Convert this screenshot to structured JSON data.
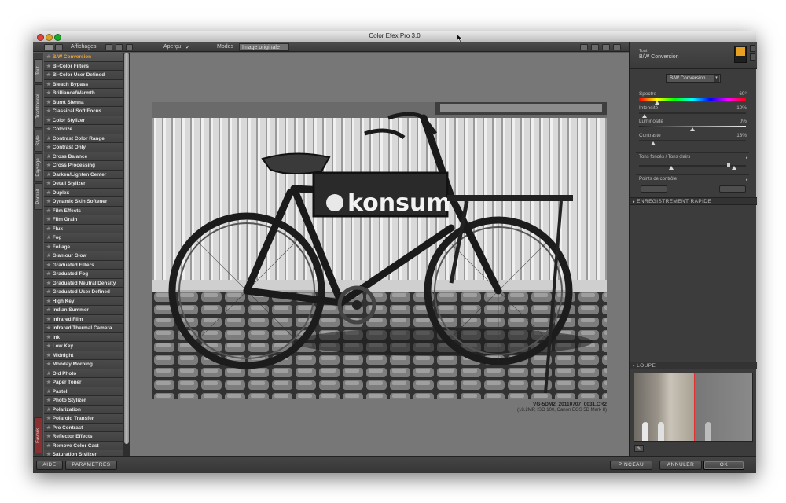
{
  "window": {
    "title": "Color Efex Pro 3.0"
  },
  "toolbar": {
    "affichages_label": "Affichages",
    "apercu_label": "Aperçu",
    "modes_label": "Modes",
    "modes_value": "Image originale"
  },
  "left_tabs": [
    "Tout",
    "Traditionnel",
    "Style",
    "Paysage",
    "Portrait"
  ],
  "favoris_label": "Favoris",
  "filters": [
    "B/W Conversion",
    "Bi-Color Filters",
    "Bi-Color User Defined",
    "Bleach Bypass",
    "Brilliance/Warmth",
    "Burnt Sienna",
    "Classical Soft Focus",
    "Color Stylizer",
    "Colorize",
    "Contrast Color Range",
    "Contrast Only",
    "Cross Balance",
    "Cross Processing",
    "Darken/Lighten Center",
    "Detail Stylizer",
    "Duplex",
    "Dynamic Skin Softener",
    "Film Effects",
    "Film Grain",
    "Flux",
    "Fog",
    "Foliage",
    "Glamour Glow",
    "Graduated Filters",
    "Graduated Fog",
    "Graduated Neutral Density",
    "Graduated User Defined",
    "High Key",
    "Indian Summer",
    "Infrared Film",
    "Infrared Thermal Camera",
    "Ink",
    "Low Key",
    "Midnight",
    "Monday Morning",
    "Old Photo",
    "Paper Toner",
    "Pastel",
    "Photo Stylizer",
    "Polarization",
    "Polaroid Transfer",
    "Pro Contrast",
    "Reflector Effects",
    "Remove Color Cast",
    "Saturation Stylizer"
  ],
  "selected_filter": "B/W Conversion",
  "photo": {
    "sign_text": "konsum",
    "file_name": "VG-5DM2_20110707_0031.CR2",
    "file_info": "(18.2MP, ISO 100, Canon EOS 5D Mark II)"
  },
  "right_panel": {
    "breadcrumb": "Tout",
    "filter_title": "B/W Conversion",
    "dropdown_value": "B/W Conversion",
    "sliders": [
      {
        "label": "Spectre",
        "value_text": "60°",
        "level": 0.17
      },
      {
        "label": "Intensité",
        "value_text": "10%",
        "level": 0.05
      },
      {
        "label": "Luminosité",
        "value_text": "0%",
        "level": 0.5
      },
      {
        "label": "Contraste",
        "value_text": "13%",
        "level": 0.13
      }
    ],
    "tones_label": "Tons foncés / Tons clairs",
    "control_points_label": "Points de contrôle",
    "quick_save_label": "ENREGISTREMENT RAPIDE",
    "loupe_label": "LOUPE"
  },
  "bottom": {
    "aide": "AIDE",
    "parametres": "PARAMETRES",
    "pinceau": "PINCEAU",
    "annuler": "ANNULER",
    "ok": "OK"
  },
  "colors": {
    "selected_filter": "#f0a030",
    "favoris_tab": "#8a3030",
    "badge": "#e8a020"
  }
}
